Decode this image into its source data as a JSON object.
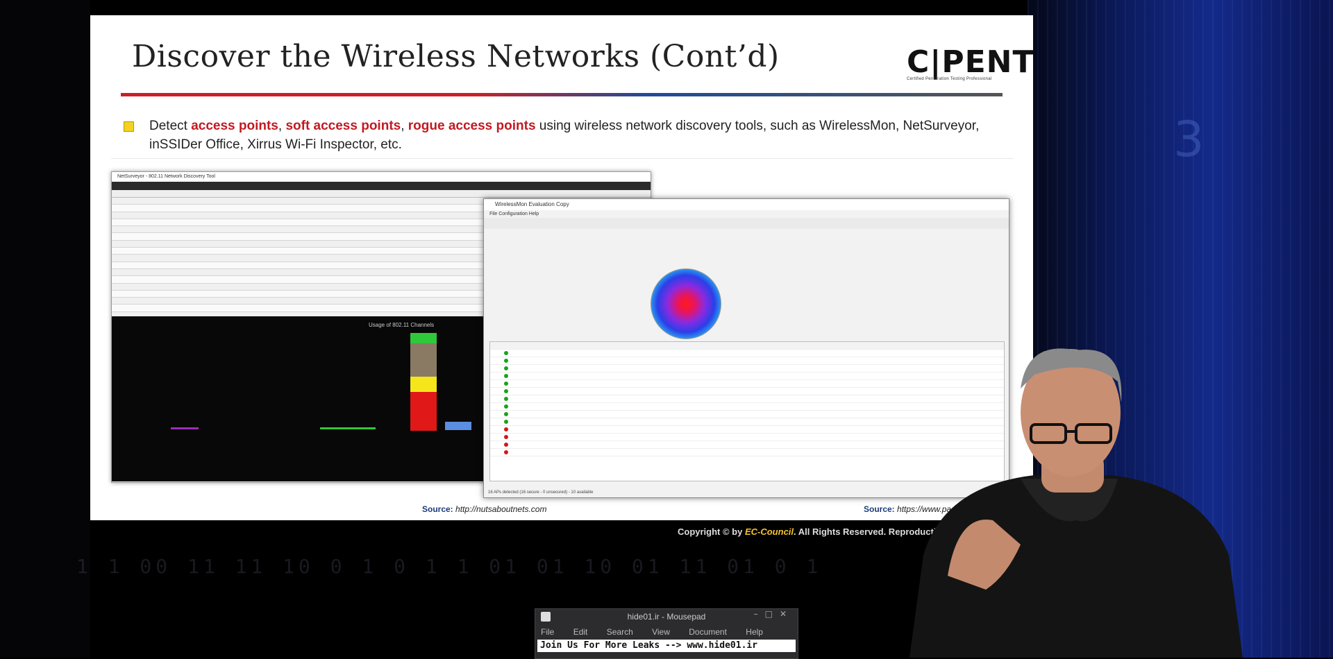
{
  "slide": {
    "title": "Discover the Wireless Networks (Cont’d)",
    "logo_text": "C|PENT",
    "logo_subtitle": "Certified Penetration Testing Professional",
    "bullet": {
      "pre": "Detect ",
      "hl1": "access points",
      "sep1": ", ",
      "hl2": "soft access points",
      "sep2": ", ",
      "hl3": "rogue access points",
      "post": " using wireless network discovery tools, such as WirelessMon, NetSurveyor, inSSIDer Office, Xirrus Wi-Fi Inspector, etc."
    },
    "shot1": {
      "window_title": "NetSurveyor - 802.11 Network Discovery Tool",
      "chart_title": "Usage of 802.11 Channels"
    },
    "shot2": {
      "window_title": "WirelessMon Evaluation Copy",
      "menu": "File   Configuration   Help",
      "status": "16 APs detected (16 secure - 0 unsecured) - 10 available"
    },
    "source_left_label": "Source:",
    "source_left_url": "http://nutsaboutnets.com",
    "source_right_label": "Source:",
    "source_right_url": "https://www.pas",
    "copyright_pre": "Copyright © by ",
    "copyright_brand": "EC-Council",
    "copyright_post": ". All Rights Reserved. Reproductio"
  },
  "mousepad": {
    "title": "hide01.ir - Mousepad",
    "menu": [
      "File",
      "Edit",
      "Search",
      "View",
      "Document",
      "Help"
    ],
    "text": "Join Us For More Leaks --> www.hide01.ir"
  }
}
